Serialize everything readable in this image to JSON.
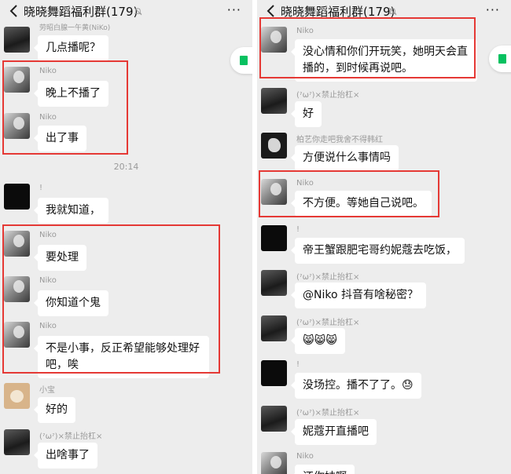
{
  "left": {
    "header": {
      "title": "晓晓舞蹈福利群(179)",
      "more": "···"
    },
    "top_name_clipped": "劳昭白腺一午黄(NiKo)",
    "messages": [
      {
        "sender": "",
        "text": "几点播呢？"
      },
      {
        "sender": "Niko",
        "text": "晚上不播了"
      },
      {
        "sender": "Niko",
        "text": "出了事"
      },
      {
        "time": "20:14"
      },
      {
        "sender": "!",
        "text": "我就知道，"
      },
      {
        "sender": "Niko",
        "text": "要处理"
      },
      {
        "sender": "Niko",
        "text": "你知道个鬼"
      },
      {
        "sender": "Niko",
        "text_line1": "不是小事，反正希望能够处理好",
        "text_line2": "吧，唉"
      },
      {
        "sender": "小宝",
        "text": "好的"
      },
      {
        "sender": "(ˀωˀ)×禁止抬杠×",
        "text": "出啥事了"
      }
    ]
  },
  "right": {
    "header": {
      "title": "晓晓舞蹈福利群(179)",
      "more": "···"
    },
    "messages": [
      {
        "sender": "Niko",
        "text_line1": "没心情和你们开玩笑，她明天会直",
        "text_line2": "播的，到时候再说吧。"
      },
      {
        "sender": "(ˀωˀ)×禁止抬杠×",
        "text": "好"
      },
      {
        "sender": "柏艺你走吧我舍不得韩红",
        "text": "方便说什么事情吗"
      },
      {
        "sender": "Niko",
        "text": "不方便。等她自己说吧。"
      },
      {
        "sender": "!",
        "text": "帝王蟹跟肥宅哥约妮蔻去吃饭，"
      },
      {
        "sender": "(ˀωˀ)×禁止抬杠×",
        "text": "@Niko 抖音有啥秘密？"
      },
      {
        "sender": "(ˀωˀ)×禁止抬杠×",
        "text": "😸😸😸"
      },
      {
        "sender": "!",
        "text": "没场控。播不了了。😓"
      },
      {
        "sender": "(ˀωˀ)×禁止抬杠×",
        "text": "妮蔻开直播吧"
      },
      {
        "sender": "Niko",
        "text": "还你妹啊"
      }
    ]
  },
  "colors": {
    "highlight_box": "#e53935",
    "chat_bg": "#ededed",
    "bubble": "#ffffff",
    "accent": "#07c160"
  }
}
